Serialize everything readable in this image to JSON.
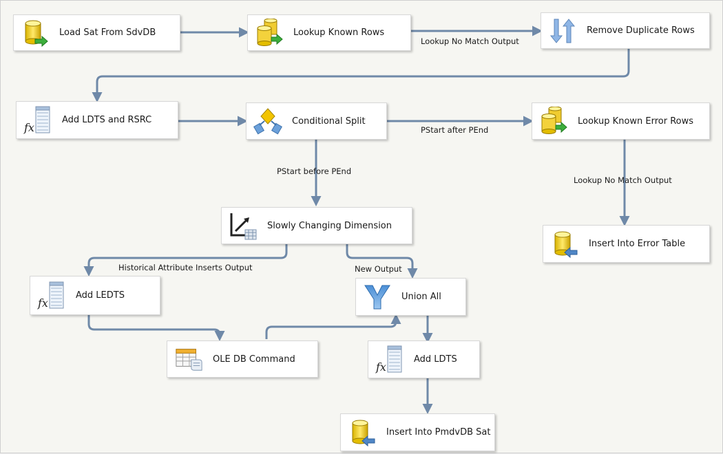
{
  "data_flow": {
    "nodes": {
      "load_sat": {
        "label": "Load Sat From SdvDB",
        "icon": "ole-db-source-icon"
      },
      "lookup_known": {
        "label": "Lookup Known Rows",
        "icon": "lookup-icon"
      },
      "remove_dup": {
        "label": "Remove Duplicate Rows",
        "icon": "sort-icon"
      },
      "add_ldts_rsrc": {
        "label": "Add LDTS and RSRC",
        "icon": "derived-column-icon"
      },
      "cond_split": {
        "label": "Conditional Split",
        "icon": "conditional-split-icon"
      },
      "lookup_error": {
        "label": "Lookup Known Error Rows",
        "icon": "lookup-icon"
      },
      "scd": {
        "label": "Slowly Changing Dimension",
        "icon": "slowly-changing-dimension-icon"
      },
      "insert_error": {
        "label": "Insert Into Error Table",
        "icon": "ole-db-destination-icon"
      },
      "add_ledts": {
        "label": "Add LEDTS",
        "icon": "derived-column-icon"
      },
      "union_all": {
        "label": "Union All",
        "icon": "union-all-icon"
      },
      "ole_cmd": {
        "label": "OLE DB Command",
        "icon": "ole-db-command-icon"
      },
      "add_ldts": {
        "label": "Add LDTS",
        "icon": "derived-column-icon"
      },
      "insert_pmdv": {
        "label": "Insert Into PmdvDB Sat",
        "icon": "ole-db-destination-icon"
      }
    },
    "paths": {
      "lookup_no_match_1": "Lookup No Match Output",
      "pstart_after_pend": "PStart after PEnd",
      "pstart_before_pend": "PStart before PEnd",
      "lookup_no_match_2": "Lookup No Match Output",
      "historical_inserts": "Historical Attribute Inserts Output",
      "new_output": "New Output"
    },
    "colors": {
      "path": "#6f89a8",
      "node_bg": "#ffffff",
      "canvas_bg": "#f6f6f2"
    }
  }
}
